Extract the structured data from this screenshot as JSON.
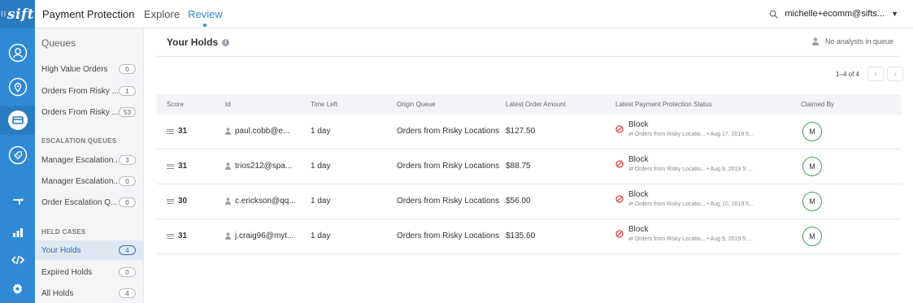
{
  "app": {
    "logo_text": "sift",
    "title": "Payment Protection"
  },
  "nav": {
    "items": [
      {
        "label": "Explore"
      },
      {
        "label": "Review"
      }
    ]
  },
  "user": {
    "email": "michelle+ecomm@sifts..."
  },
  "rail": {
    "icons": [
      "user-circle-icon",
      "location-pin-icon",
      "credit-card-icon",
      "promo-tag-icon",
      "workflow-icon",
      "bar-chart-icon",
      "code-icon",
      "settings-gear-icon"
    ]
  },
  "sidebar": {
    "title": "Queues",
    "items": [
      {
        "label": "High Value Orders",
        "count": "0"
      },
      {
        "label": "Orders From Risky ...",
        "count": "1"
      },
      {
        "label": "Orders From Risky ...",
        "count": "53"
      }
    ],
    "escalation_title": "ESCALATION QUEUES",
    "escalation_items": [
      {
        "label": "Manager Escalation...",
        "count": "3"
      },
      {
        "label": "Manager Escalation...",
        "count": "0"
      },
      {
        "label": "Order Escalation Q...",
        "count": "0"
      }
    ],
    "held_title": "HELD CASES",
    "held_items": [
      {
        "label": "Your Holds",
        "count": "4"
      },
      {
        "label": "Expired Holds",
        "count": "0"
      },
      {
        "label": "All Holds",
        "count": "4"
      }
    ]
  },
  "main": {
    "title": "Your Holds",
    "analysts_text": "No analysts in queue",
    "pager_text": "1–4 of 4",
    "columns": [
      "Score",
      "Id",
      "Time Left",
      "Origin Queue",
      "Latest Order Amount",
      "Latest Payment Protection Status",
      "Claimed By"
    ],
    "rows": [
      {
        "score": "31",
        "id": "paul.cobb@e...",
        "time_left": "1 day",
        "origin_queue": "Orders from Risky Locations",
        "amount": "$127.50",
        "status": "Block",
        "status_queue": "Orders from Risky Locatio...",
        "status_date": "• Aug 17, 2019 5...",
        "claimed": "M"
      },
      {
        "score": "31",
        "id": "trios212@spa...",
        "time_left": "1 day",
        "origin_queue": "Orders from Risky Locations",
        "amount": "$88.75",
        "status": "Block",
        "status_queue": "Orders from Risky Locatio...",
        "status_date": "• Aug 9, 2019 5:...",
        "claimed": "M"
      },
      {
        "score": "30",
        "id": "c.erickson@qq...",
        "time_left": "1 day",
        "origin_queue": "Orders from Risky Locations",
        "amount": "$56.00",
        "status": "Block",
        "status_queue": "Orders from Risky Locatio...",
        "status_date": "• Aug 10, 2019 5...",
        "claimed": "M"
      },
      {
        "score": "31",
        "id": "j.craig96@myt...",
        "time_left": "1 day",
        "origin_queue": "Orders from Risky Locations",
        "amount": "$135.60",
        "status": "Block",
        "status_queue": "Orders from Risky Locatio...",
        "status_date": "• Aug 9, 2019 5:...",
        "claimed": "M"
      }
    ]
  },
  "colors": {
    "rail": "#2f89d5",
    "accent": "#2f89d5",
    "block": "#e0443c",
    "claimed_border": "#3aa35b"
  }
}
